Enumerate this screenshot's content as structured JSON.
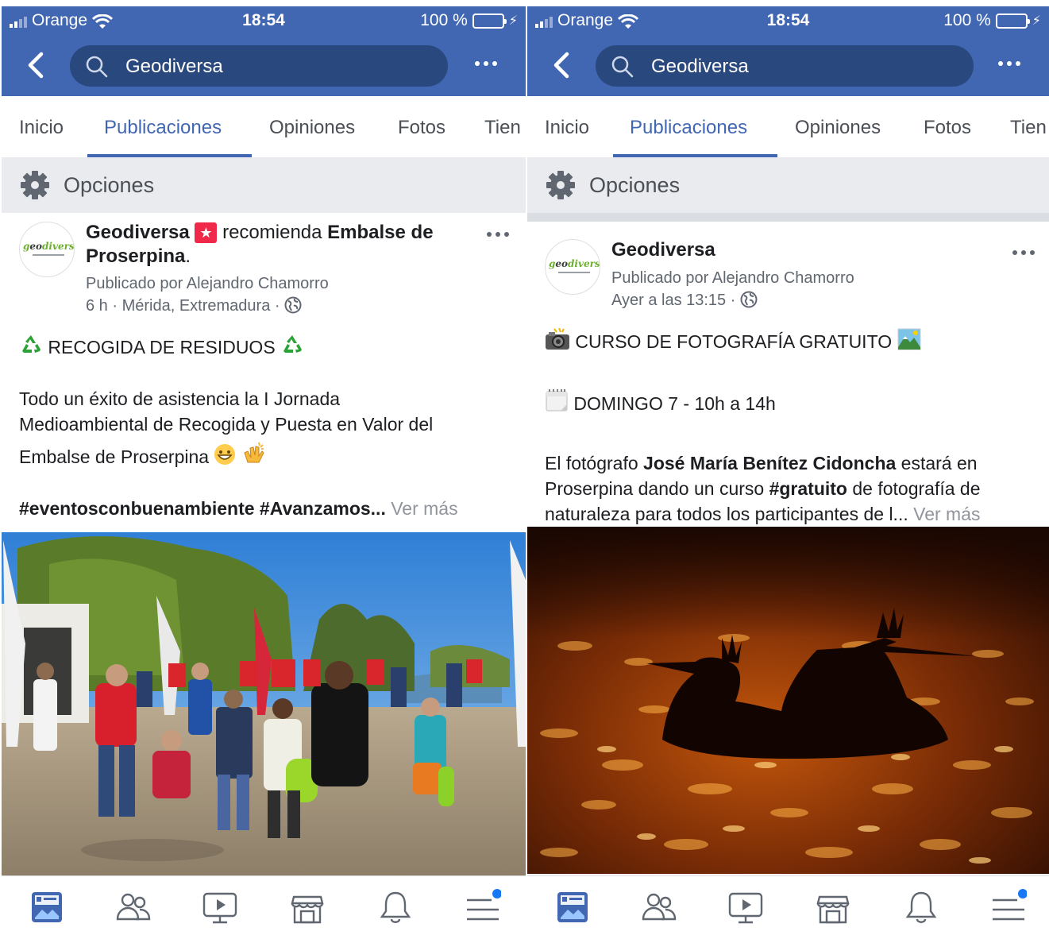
{
  "colors": {
    "brand_blue": "#4267b2",
    "search_bg": "#29487d",
    "options_bg": "#e9ebee",
    "battery_green": "#4cd964",
    "notification_dot": "#1877f2"
  },
  "screens": [
    {
      "status": {
        "carrier": "Orange",
        "time": "18:54",
        "battery": "100 %"
      },
      "search": {
        "query": "Geodiversa"
      },
      "tabs": [
        "Inicio",
        "Publicaciones",
        "Opiniones",
        "Fotos",
        "Tien"
      ],
      "active_tab": "Publicaciones",
      "options_label": "Opciones",
      "post": {
        "author": "Geodiversa",
        "verb": "recomienda",
        "place_line1": "Embalse de",
        "place_line2": "Proserpina",
        "place_suffix": ".",
        "published_by": "Publicado por Alejandro Chamorro",
        "time_place": "6 h · Mérida, Extremadura ·",
        "heading": "RECOGIDA DE RESIDUOS",
        "p1_line1": "Todo un éxito de asistencia la I Jornada",
        "p1_line2": "Medioambiental de Recogida y Puesta en Valor del",
        "p1_line3": "Embalse de Proserpina",
        "hashtags": "#eventosconbuenambiente #Avanzamos...",
        "see_more": "Ver más",
        "photo_icon": "people-walking-photo"
      },
      "bottom_nav": [
        "news-feed-icon",
        "friends-icon",
        "watch-icon",
        "marketplace-icon",
        "notifications-icon",
        "menu-icon"
      ]
    },
    {
      "status": {
        "carrier": "Orange",
        "time": "18:54",
        "battery": "100 %"
      },
      "search": {
        "query": "Geodiversa"
      },
      "tabs": [
        "Inicio",
        "Publicaciones",
        "Opiniones",
        "Fotos",
        "Tien"
      ],
      "active_tab": "Publicaciones",
      "options_label": "Opciones",
      "post": {
        "author": "Geodiversa",
        "published_by": "Publicado por Alejandro Chamorro",
        "time": "Ayer a las 13:15 ·",
        "heading": "CURSO DE FOTOGRAFÍA GRATUITO",
        "date_line": "DOMINGO 7 - 10h a 14h",
        "p1_a": "El fotógrafo ",
        "p1_b": "José María Benítez Cidoncha",
        "p1_c": " estará en",
        "p2_a": "Proserpina dando un curso ",
        "p2_b": "#gratuito",
        "p2_c": " de fotografía de",
        "p3": "naturaleza para todos los participantes de l...",
        "see_more": "Ver más",
        "photo_icon": "grebes-silhouette-photo"
      },
      "bottom_nav": [
        "news-feed-icon",
        "friends-icon",
        "watch-icon",
        "marketplace-icon",
        "notifications-icon",
        "menu-icon"
      ]
    }
  ]
}
